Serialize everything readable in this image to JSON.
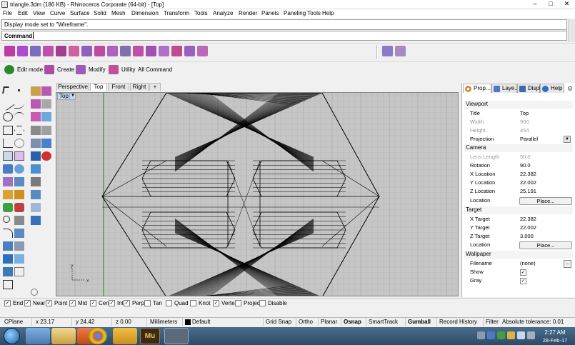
{
  "window": {
    "title": "triangle.3dm (186 KB) - Rhinoceros Corporate (64-bit) - [Top]",
    "minimize_glyph": "–",
    "maximize_glyph": "□",
    "close_glyph": "✕"
  },
  "menu": [
    "File",
    "Edit",
    "View",
    "Curve",
    "Surface",
    "Solid",
    "Mesh",
    "Dimension",
    "Transform",
    "Tools",
    "Analyze",
    "Render",
    "Panels",
    "Paneling Tools",
    "Help"
  ],
  "command": {
    "history": "Display mode set to \"Wireframe\".",
    "prompt": "Command:"
  },
  "toolbar2": {
    "edit_mode": "Edit mode",
    "create": "Create",
    "modify": "Modify",
    "utility": "Utility",
    "all_command": "All Command"
  },
  "viewport_tabs": [
    "Perspective",
    "Top",
    "Front",
    "Right",
    "+"
  ],
  "active_viewport": "Top",
  "viewport_label": "Top",
  "viewport_menu_glyph": "▼",
  "axis": {
    "y": "y",
    "x": "x"
  },
  "panel": {
    "tabs": [
      "Prop...",
      "Laye...",
      "Displ...",
      "Help"
    ],
    "gear_glyph": "⚙",
    "sections": {
      "viewport": "Viewport",
      "camera": "Camera",
      "target": "Target",
      "wallpaper": "Wallpaper"
    },
    "viewport_rows": [
      {
        "label": "Title",
        "value": "Top",
        "disabled": false
      },
      {
        "label": "Width",
        "value": "900",
        "disabled": true
      },
      {
        "label": "Height",
        "value": "454",
        "disabled": true
      },
      {
        "label": "Projection",
        "value": "Parallel",
        "disabled": false
      }
    ],
    "camera_rows": [
      {
        "label": "Lens Length",
        "value": "50.0",
        "disabled": true
      },
      {
        "label": "Rotation",
        "value": "90.0",
        "disabled": false
      },
      {
        "label": "X Location",
        "value": "22.382",
        "disabled": false
      },
      {
        "label": "Y Location",
        "value": "22.002",
        "disabled": false
      },
      {
        "label": "Z Location",
        "value": "25.191",
        "disabled": false
      },
      {
        "label": "Location",
        "value": "",
        "disabled": false
      }
    ],
    "camera_place_button": "Place...",
    "target_rows": [
      {
        "label": "X Target",
        "value": "22.382",
        "disabled": false
      },
      {
        "label": "Y Target",
        "value": "22.002",
        "disabled": false
      },
      {
        "label": "Z Target",
        "value": "3.000",
        "disabled": false
      },
      {
        "label": "Location",
        "value": "",
        "disabled": false
      }
    ],
    "target_place_button": "Place...",
    "wallpaper_rows": [
      {
        "label": "Filename",
        "value": "(none)"
      },
      {
        "label": "Show",
        "checked": true
      },
      {
        "label": "Gray",
        "checked": true
      }
    ],
    "filename_button": "...",
    "dropdown_glyph": "▼"
  },
  "osnap": [
    {
      "label": "End",
      "checked": true
    },
    {
      "label": "Near",
      "checked": true
    },
    {
      "label": "Point",
      "checked": true
    },
    {
      "label": "Mid",
      "checked": true
    },
    {
      "label": "Cen",
      "checked": true
    },
    {
      "label": "Int",
      "checked": true
    },
    {
      "label": "Perp",
      "checked": true
    },
    {
      "label": "Tan",
      "checked": false
    },
    {
      "label": "Quad",
      "checked": false
    },
    {
      "label": "Knot",
      "checked": false
    },
    {
      "label": "Vertex",
      "checked": true
    },
    {
      "label": "Project",
      "checked": false
    },
    {
      "label": "Disable",
      "checked": false
    }
  ],
  "status": {
    "cplane": "CPlane",
    "x": "x 23.17",
    "y": "y 24.42",
    "z": "z 0.00",
    "units": "Millimeters",
    "layer": "Default",
    "toggles": [
      "Grid Snap",
      "Ortho",
      "Planar",
      "Osnap",
      "SmartTrack",
      "Gumball",
      "Record History",
      "Filter"
    ],
    "bold_toggles": [
      "Osnap",
      "Gumball"
    ],
    "tolerance": "Absolute tolerance: 0.01"
  },
  "taskbar": {
    "time": "2:27 AM",
    "date": "28-Feb-17",
    "mu_label": "Mu"
  },
  "colors": {
    "accent_blue": "#3d7fc4",
    "viewport_bg": "#c6c6c6",
    "grid": "#b3b3b3",
    "grid_major": "#9a9a9a",
    "y_axis": "#2a9a2a",
    "x_axis": "#b02020"
  }
}
